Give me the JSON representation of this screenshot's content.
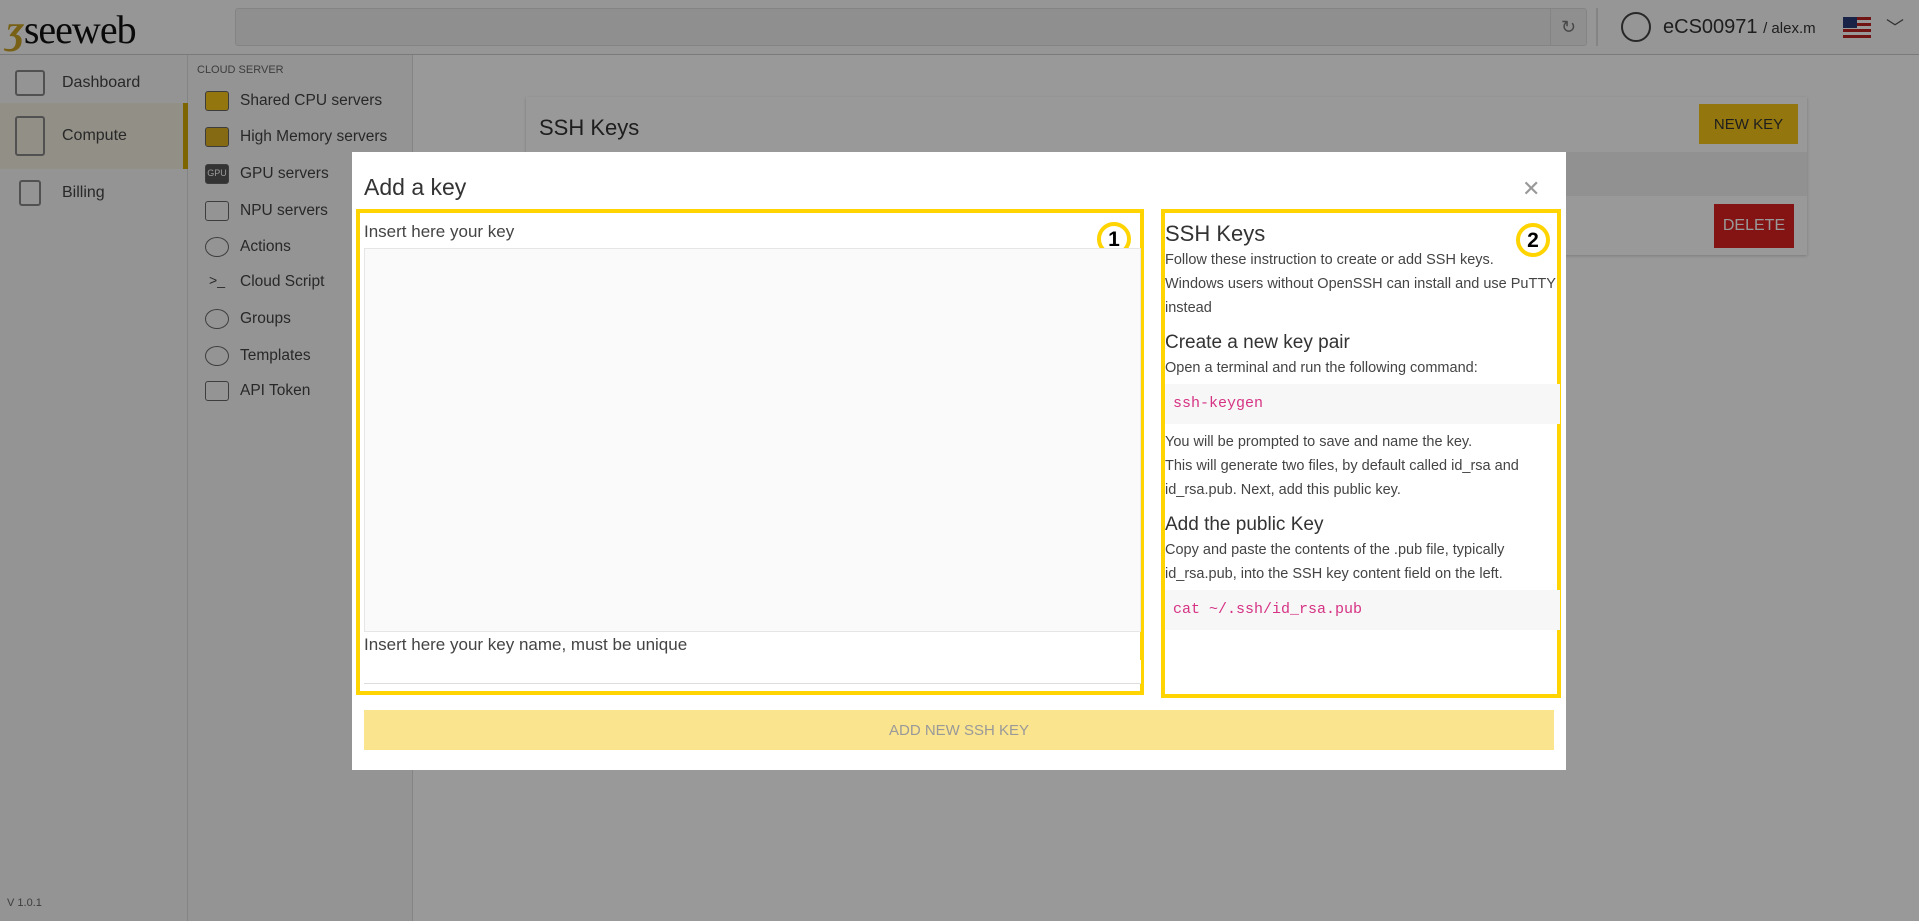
{
  "header": {
    "logo": "seeweb",
    "account_id": "eCS00971",
    "username": "/ alex.m",
    "language": "en-US"
  },
  "sidebar": {
    "items": [
      {
        "label": "Dashboard"
      },
      {
        "label": "Compute",
        "active": true
      },
      {
        "label": "Billing"
      }
    ],
    "version": "V 1.0.1"
  },
  "subnav": {
    "section": "CLOUD SERVER",
    "items": [
      {
        "label": "Shared CPU servers"
      },
      {
        "label": "High Memory servers"
      },
      {
        "label": "GPU servers"
      },
      {
        "label": "NPU servers"
      },
      {
        "label": "Actions"
      },
      {
        "label": "Cloud Script"
      },
      {
        "label": "Groups"
      },
      {
        "label": "Templates"
      },
      {
        "label": "API Token"
      }
    ]
  },
  "main": {
    "title": "SSH Keys",
    "new_key": "NEW KEY",
    "delete": "DELETE"
  },
  "modal": {
    "title": "Add a key",
    "key_label": "Insert here your key",
    "key_value": "",
    "name_label": "Insert here your key name, must be unique",
    "name_value": "",
    "submit": "ADD NEW SSH KEY",
    "annotations": [
      "1",
      "2"
    ],
    "help": {
      "title": "SSH Keys",
      "intro1": "Follow these instruction to create or add SSH keys.",
      "intro2": "Windows users without OpenSSH can install and use PuTTY instead",
      "h_create": "Create a new key pair",
      "create_text": "Open a terminal and run the following command:",
      "cmd1": "ssh-keygen",
      "after1": "You will be prompted to save and name the key.",
      "after2": "This will generate two files, by default called id_rsa and id_rsa.pub. Next, add this public key.",
      "h_add": "Add the public Key",
      "add_text": "Copy and paste the contents of the .pub file, typically id_rsa.pub, into the SSH key content field on the left.",
      "cmd2": "cat ~/.ssh/id_rsa.pub"
    }
  },
  "colors": {
    "accent": "#f5c518",
    "danger": "#dd2222",
    "annotation": "#ffd400",
    "code": "#d63384"
  }
}
